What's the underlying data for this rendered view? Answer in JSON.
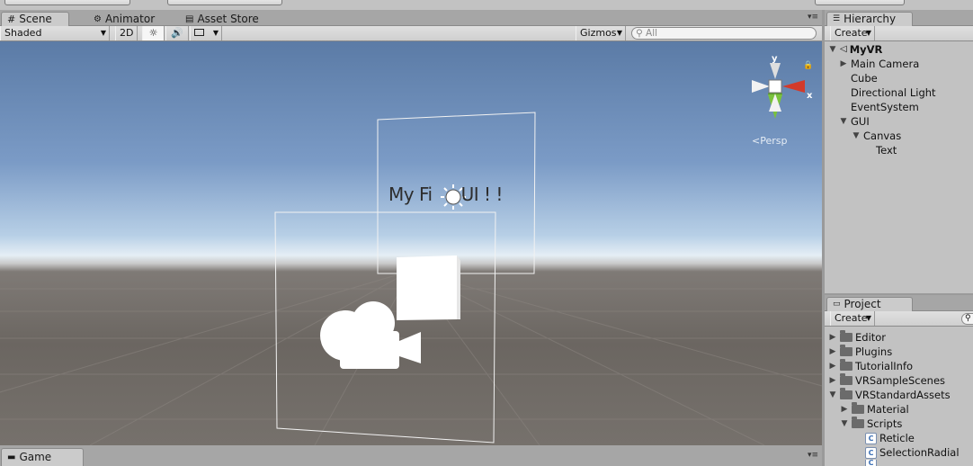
{
  "scene_tabs": [
    {
      "label": "Scene",
      "icon": "grid-icon"
    },
    {
      "label": "Animator",
      "icon": "animator-icon"
    },
    {
      "label": "Asset Store",
      "icon": "store-icon"
    }
  ],
  "scene_toolbar": {
    "shading_mode": "Shaded",
    "mode_2d": "2D",
    "gizmos_label": "Gizmos",
    "search_placeholder": "All"
  },
  "viewport": {
    "ui_text": "My Fi",
    "ui_text_rest": "UI ! !",
    "persp_label": "Persp",
    "axis_y": "y",
    "axis_x": "x"
  },
  "hierarchy": {
    "tab_label": "Hierarchy",
    "create_label": "Create",
    "items": [
      {
        "label": "MyVR",
        "depth": 0,
        "expanded": true,
        "has_children": true,
        "scene_root": true
      },
      {
        "label": "Main Camera",
        "depth": 1,
        "expanded": false,
        "has_children": true
      },
      {
        "label": "Cube",
        "depth": 1,
        "has_children": false
      },
      {
        "label": "Directional Light",
        "depth": 1,
        "has_children": false
      },
      {
        "label": "EventSystem",
        "depth": 1,
        "has_children": false
      },
      {
        "label": "GUI",
        "depth": 1,
        "expanded": true,
        "has_children": true
      },
      {
        "label": "Canvas",
        "depth": 2,
        "expanded": true,
        "has_children": true
      },
      {
        "label": "Text",
        "depth": 3,
        "has_children": false
      }
    ]
  },
  "project": {
    "tab_label": "Project",
    "create_label": "Create",
    "items": [
      {
        "label": "Editor",
        "depth": 0,
        "type": "folder",
        "expanded": false
      },
      {
        "label": "Plugins",
        "depth": 0,
        "type": "folder",
        "expanded": false
      },
      {
        "label": "TutorialInfo",
        "depth": 0,
        "type": "folder",
        "expanded": false
      },
      {
        "label": "VRSampleScenes",
        "depth": 0,
        "type": "folder",
        "expanded": false
      },
      {
        "label": "VRStandardAssets",
        "depth": 0,
        "type": "folder",
        "expanded": true
      },
      {
        "label": "Material",
        "depth": 1,
        "type": "folder",
        "expanded": false
      },
      {
        "label": "Scripts",
        "depth": 1,
        "type": "folder",
        "expanded": true
      },
      {
        "label": "Reticle",
        "depth": 2,
        "type": "script"
      },
      {
        "label": "SelectionRadial",
        "depth": 2,
        "type": "script"
      }
    ]
  },
  "game_tab": {
    "label": "Game",
    "icon": "game-icon"
  },
  "colors": {
    "x_axis": "#d23a2a",
    "y_axis": "#7ac23c",
    "panel_bg": "#c2c2c2",
    "accent_select": "#3d7bd1"
  }
}
